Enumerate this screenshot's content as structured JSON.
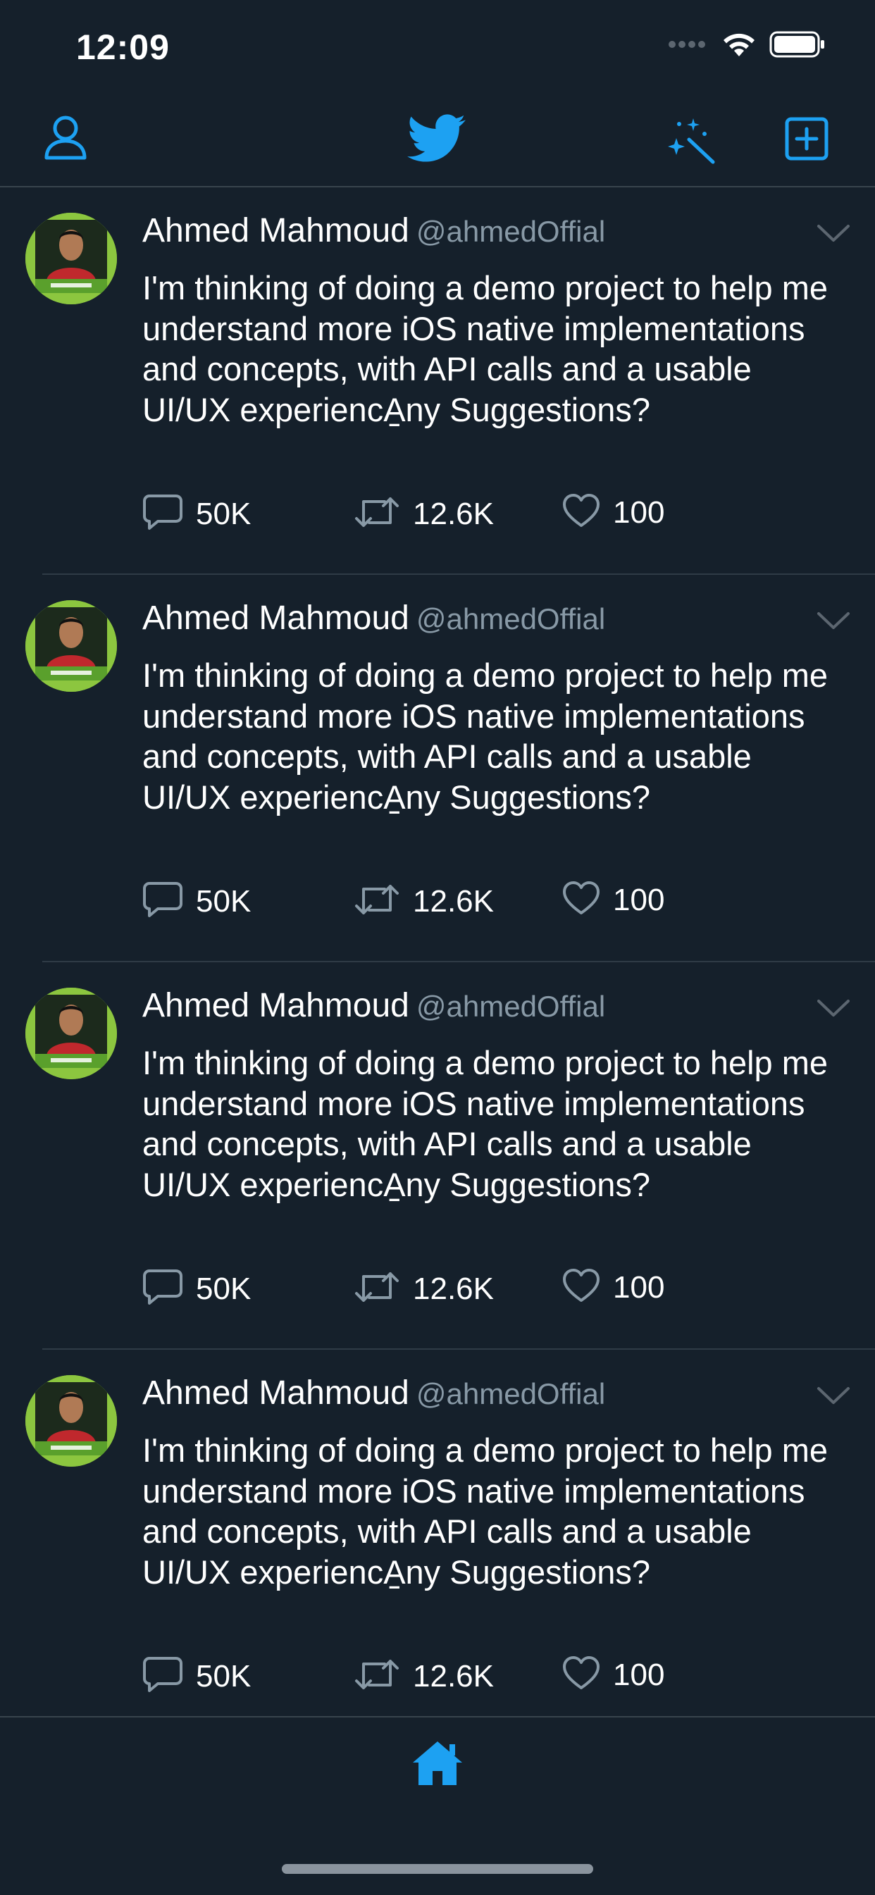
{
  "status_bar": {
    "time": "12:09",
    "icons": [
      "signal-dots-icon",
      "wifi-icon",
      "battery-icon"
    ]
  },
  "nav_bar": {
    "icons": [
      "profile-icon",
      "twitter-bird-logo",
      "sparkle-wand-icon",
      "compose-icon"
    ],
    "accent_color": "#1da1f2"
  },
  "tweets": [
    {
      "name": "Ahmed Mahmoud",
      "handle": "@ahmedOffial",
      "text": "I'm thinking of doing a demo project to help me understand more iOS native implementations and concepts, with API calls and a usable UI/UX experiencA̠ny Suggestions?",
      "replies": "50K",
      "retweets": "12.6K",
      "likes": "100"
    },
    {
      "name": "Ahmed Mahmoud",
      "handle": "@ahmedOffial",
      "text": "I'm thinking of doing a demo project to help me understand more iOS native implementations and concepts, with API calls and a usable UI/UX experiencA̠ny Suggestions?",
      "replies": "50K",
      "retweets": "12.6K",
      "likes": "100"
    },
    {
      "name": "Ahmed Mahmoud",
      "handle": "@ahmedOffial",
      "text": "I'm thinking of doing a demo project to help me understand more iOS native implementations and concepts, with API calls and a usable UI/UX experiencA̠ny Suggestions?",
      "replies": "50K",
      "retweets": "12.6K",
      "likes": "100"
    },
    {
      "name": "Ahmed Mahmoud",
      "handle": "@ahmedOffial",
      "text": "I'm thinking of doing a demo project to help me understand more iOS native implementations and concepts, with API calls and a usable UI/UX experiencA̠ny Suggestions?",
      "replies": "50K",
      "retweets": "12.6K",
      "likes": "100"
    }
  ],
  "tab_bar": {
    "icons": [
      "home-icon"
    ]
  },
  "colors": {
    "background": "#15202b",
    "accent": "#1da1f2",
    "secondary_text": "#8899a6",
    "divider": "#38444d"
  }
}
